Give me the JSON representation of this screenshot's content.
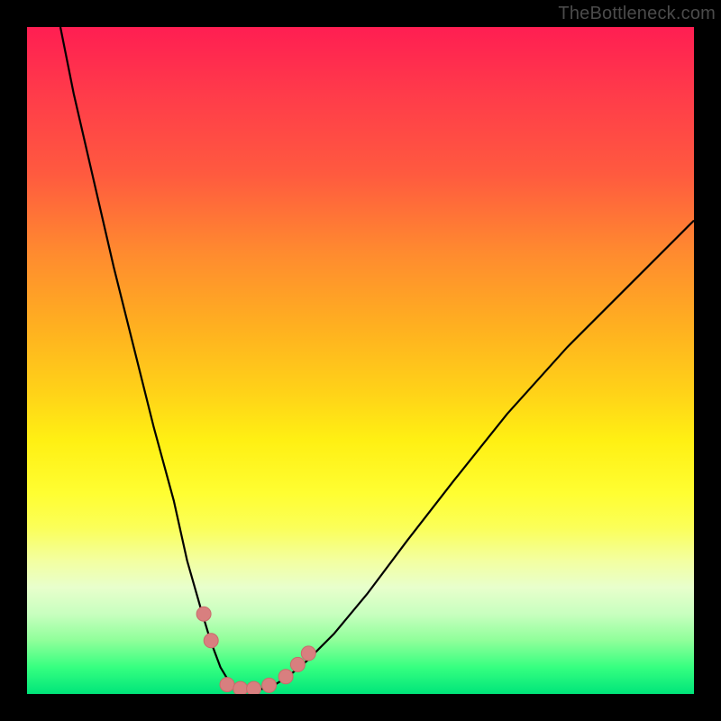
{
  "watermark": "TheBottleneck.com",
  "colors": {
    "frame": "#000000",
    "curve": "#000000",
    "markers_fill": "#d87f7f",
    "markers_stroke": "#c96b6b",
    "gradient_top": "#ff1e52",
    "gradient_bottom": "#00e57a"
  },
  "chart_data": {
    "type": "line",
    "title": "",
    "xlabel": "",
    "ylabel": "",
    "xlim": [
      0,
      100
    ],
    "ylim": [
      0,
      100
    ],
    "note": "No axis ticks or numeric labels are rendered in the image; x/y values are proportional estimates (0–100) read from pixel positions. y≈0 corresponds to the green band at the bottom, y≈100 to the top.",
    "series": [
      {
        "name": "curve",
        "x": [
          5,
          7,
          10,
          13,
          16,
          19,
          22,
          24,
          26,
          27.5,
          29,
          30.5,
          32,
          34,
          36.5,
          39,
          42,
          46,
          51,
          57,
          64,
          72,
          81,
          91,
          100
        ],
        "y": [
          100,
          90,
          77,
          64,
          52,
          40,
          29,
          20,
          13,
          8,
          4,
          1.5,
          0.5,
          0.5,
          1.0,
          2.5,
          5,
          9,
          15,
          23,
          32,
          42,
          52,
          62,
          71
        ]
      }
    ],
    "markers": [
      {
        "x": 26.5,
        "y": 12.0
      },
      {
        "x": 27.6,
        "y": 8.0
      },
      {
        "x": 30.0,
        "y": 1.4
      },
      {
        "x": 32.0,
        "y": 0.8
      },
      {
        "x": 34.0,
        "y": 0.8
      },
      {
        "x": 36.3,
        "y": 1.3
      },
      {
        "x": 38.8,
        "y": 2.6
      },
      {
        "x": 40.6,
        "y": 4.4
      },
      {
        "x": 42.2,
        "y": 6.1
      }
    ],
    "marker_radius_px": 8
  }
}
